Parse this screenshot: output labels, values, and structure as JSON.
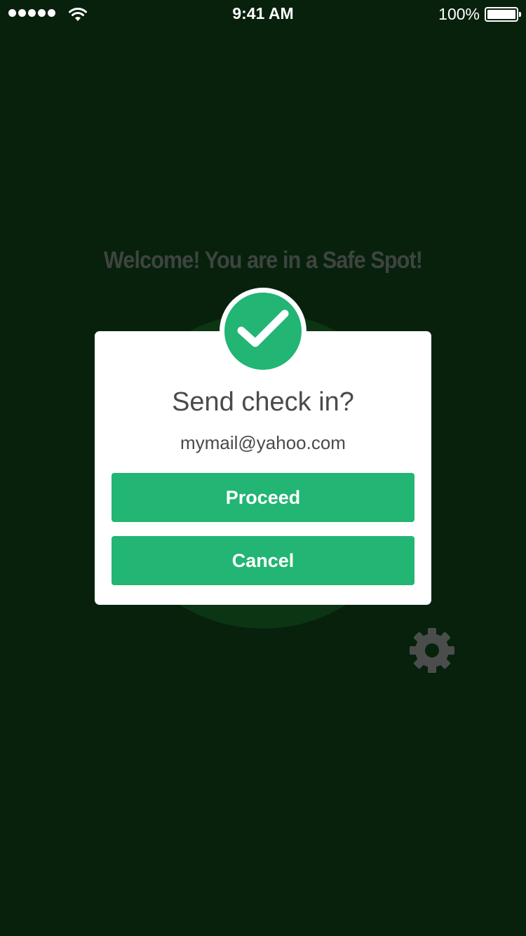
{
  "status_bar": {
    "time": "9:41 AM",
    "battery_percent": "100%",
    "signal_bars": 5,
    "wifi_icon": "wifi-icon",
    "battery_icon": "battery-icon"
  },
  "background": {
    "welcome_text": "Welcome! You are in a Safe Spot!",
    "settings_icon": "gear-icon"
  },
  "dialog": {
    "icon": "checkmark-icon",
    "title": "Send check in?",
    "email": "mymail@yahoo.com",
    "proceed_label": "Proceed",
    "cancel_label": "Cancel"
  },
  "colors": {
    "background": "#07210d",
    "accent_green": "#22b573",
    "dialog_text": "#4a4a4a"
  }
}
